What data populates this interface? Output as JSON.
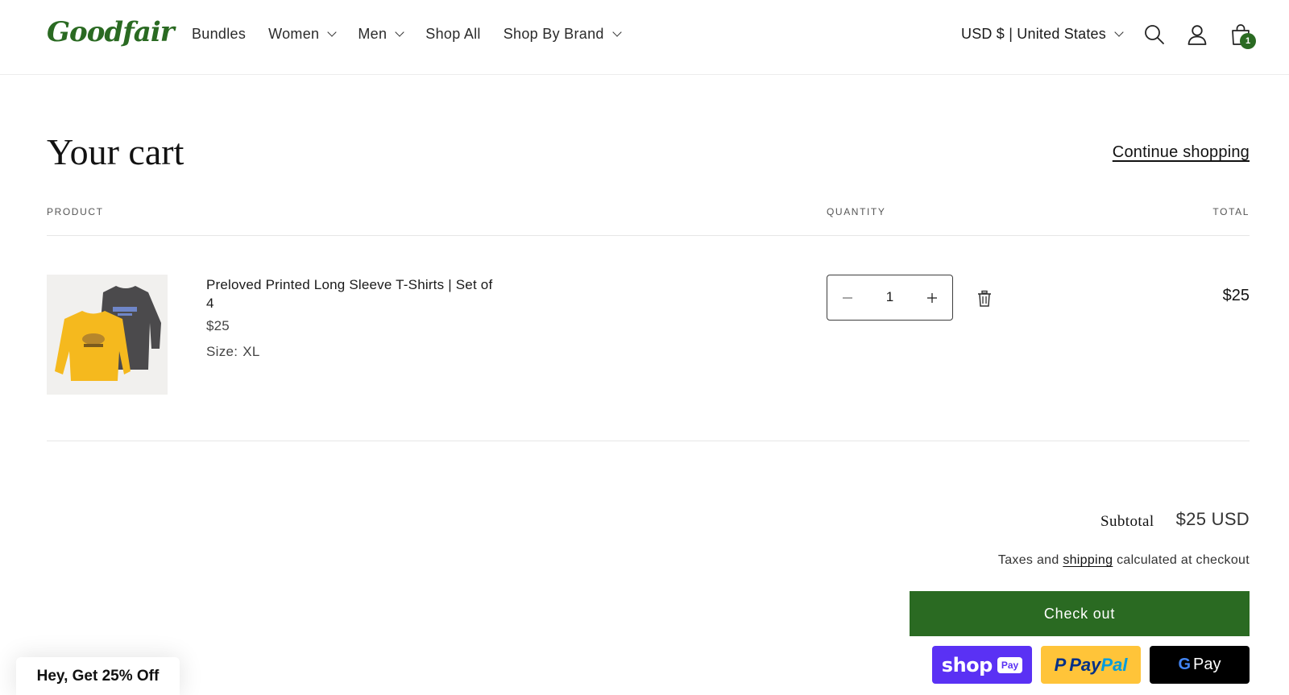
{
  "brand": {
    "logo_text": "Goodfair",
    "accent_color": "#2a6a22"
  },
  "nav": {
    "items": [
      {
        "label": "Bundles",
        "has_dropdown": false
      },
      {
        "label": "Women",
        "has_dropdown": true
      },
      {
        "label": "Men",
        "has_dropdown": true
      },
      {
        "label": "Shop All",
        "has_dropdown": false
      },
      {
        "label": "Shop By Brand",
        "has_dropdown": true
      }
    ]
  },
  "header": {
    "currency_label": "USD $ | United States",
    "icons": [
      "search-icon",
      "account-icon",
      "cart-icon"
    ],
    "cart_count": "1"
  },
  "page": {
    "title": "Your cart",
    "continue_label": "Continue shopping"
  },
  "table": {
    "col_product": "PRODUCT",
    "col_quantity": "QUANTITY",
    "col_total": "TOTAL"
  },
  "item": {
    "name": "Preloved Printed Long Sleeve T-Shirts | Set of 4",
    "price": "$25",
    "size_label": "Size:",
    "size_value": "XL",
    "quantity": "1",
    "total": "$25"
  },
  "summary": {
    "subtotal_label": "Subtotal",
    "subtotal_value": "$25 USD",
    "tax_prefix": "Taxes and",
    "tax_link": "shipping",
    "tax_suffix": "calculated at checkout",
    "checkout_label": "Check out",
    "shop_pay": {
      "word": "shop",
      "badge": "Pay"
    },
    "paypal": {
      "p1": "Pay",
      "p2": "Pal"
    },
    "gpay": {
      "g": "G",
      "word": "Pay"
    }
  },
  "promo": {
    "label": "Hey, Get 25% Off"
  }
}
